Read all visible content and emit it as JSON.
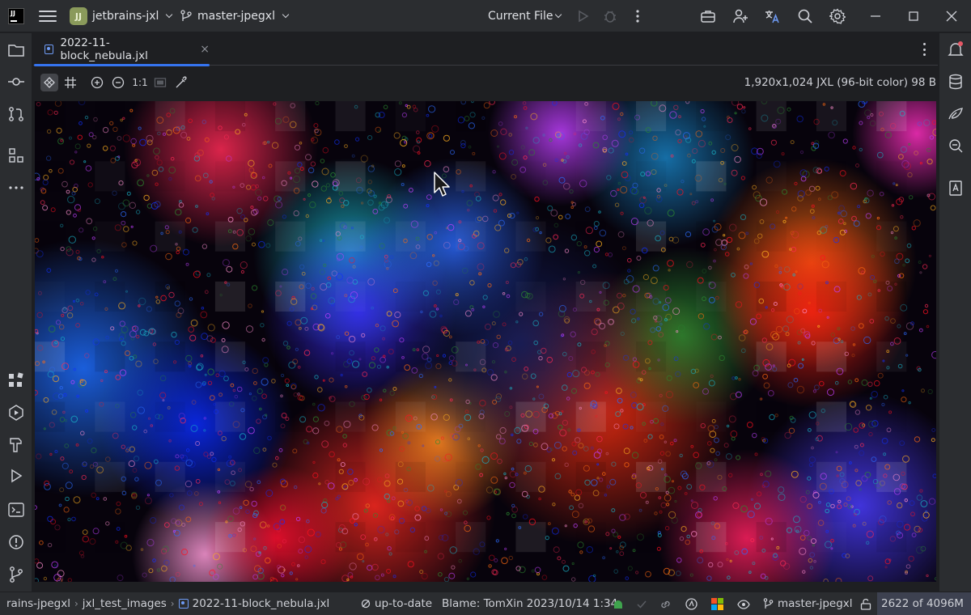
{
  "titlebar": {
    "logo_text": "JJ",
    "project_badge": "JJ",
    "project_name": "jetbrains-jxl",
    "branch": "master-jpegxl",
    "run_config": "Current File"
  },
  "tab": {
    "filename": "2022-11-block_nebula.jxl",
    "close": "×"
  },
  "image_toolbar": {
    "actual_size_label": "1:1",
    "info": "1,920x1,024 JXL (96-bit color) 98 B"
  },
  "statusbar": {
    "breadcrumb": [
      "rains-jpegxl",
      "jxl_test_images",
      "2022-11-block_nebula.jxl"
    ],
    "vcs_state": "up-to-date",
    "blame": "Blame: TomXin 2023/10/14 1:34",
    "branch": "master-jpegxl",
    "memory": "2622 of 4096M"
  },
  "colors": {
    "accent": "#3574f0",
    "panel": "#2b2d30",
    "editor_bg": "#1e1f22"
  }
}
